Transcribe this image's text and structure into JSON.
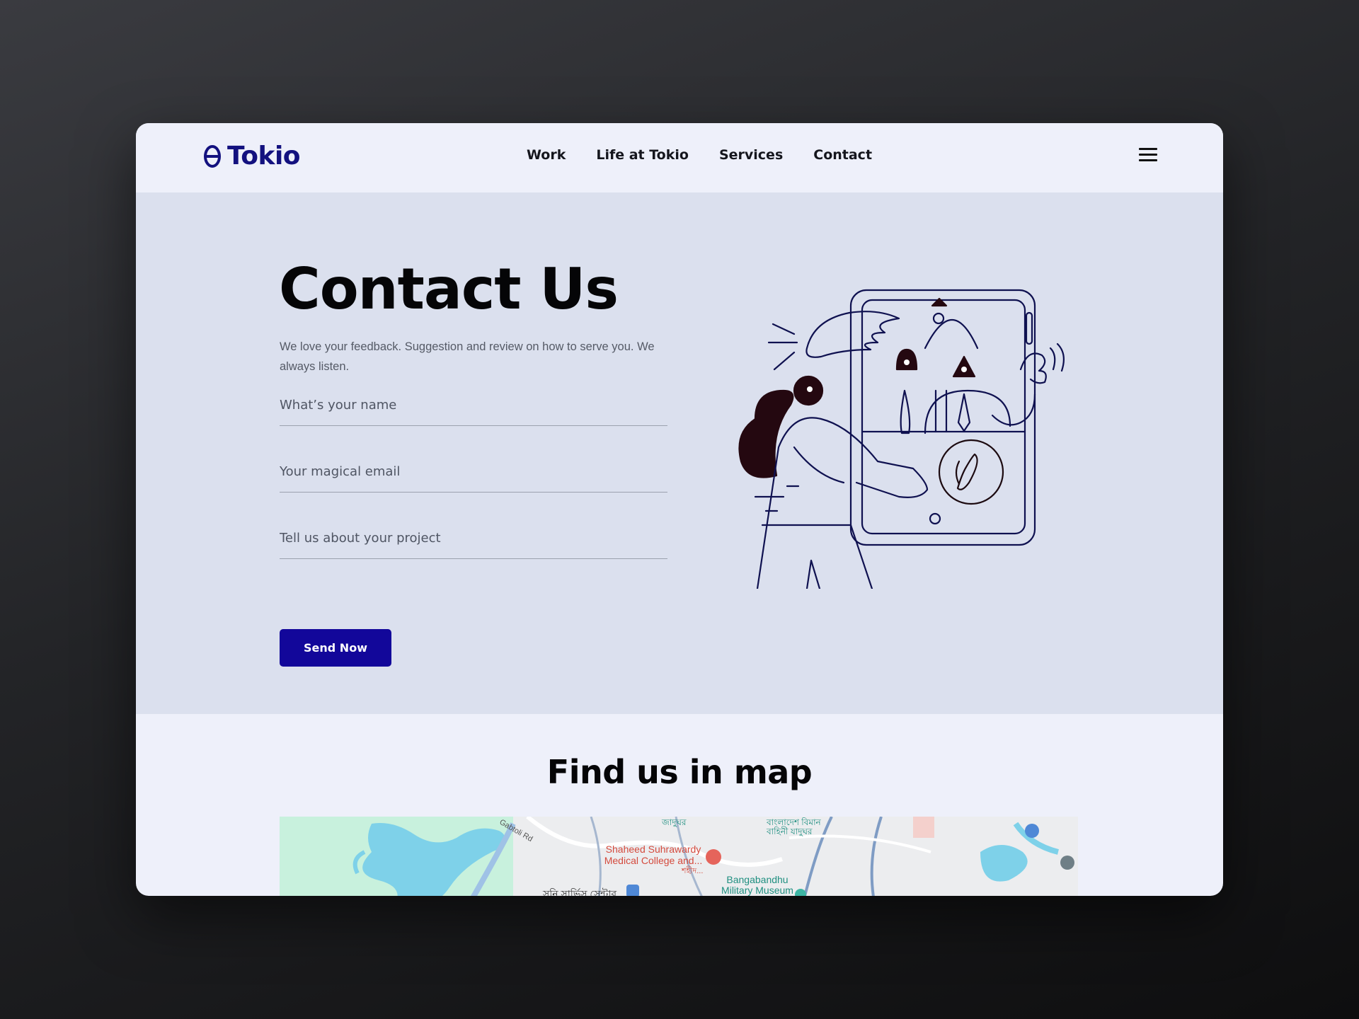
{
  "brand": {
    "name": "Tokio"
  },
  "nav": {
    "items": [
      "Work",
      "Life at Tokio",
      "Services",
      "Contact"
    ]
  },
  "hero": {
    "title": "Contact Us",
    "lead": "We love your feedback. Suggestion and review on how to serve you. We always listen."
  },
  "form": {
    "name_placeholder": "What’s your name",
    "email_placeholder": "Your magical email",
    "project_placeholder": "Tell us about your project",
    "submit_label": "Send Now"
  },
  "map_section": {
    "title": "Find us in map",
    "labels": {
      "hospital": "Shaheed Suhrawardy Medical College and...",
      "hospital_bn": "শহীদ...",
      "museum": "Bangabandhu Military Museum",
      "road": "Gabtoli Rd",
      "service": "সনি সার্ভিস সেন্টার",
      "museum_bn": "বাংলাদেশ বিমান বাহিনী যাদুঘর",
      "top_bn": "জাদুঘর"
    }
  },
  "colors": {
    "brand": "#13117f",
    "button": "#12079a",
    "hero_bg": "#dbe0ee",
    "page_bg": "#eef0fa"
  }
}
